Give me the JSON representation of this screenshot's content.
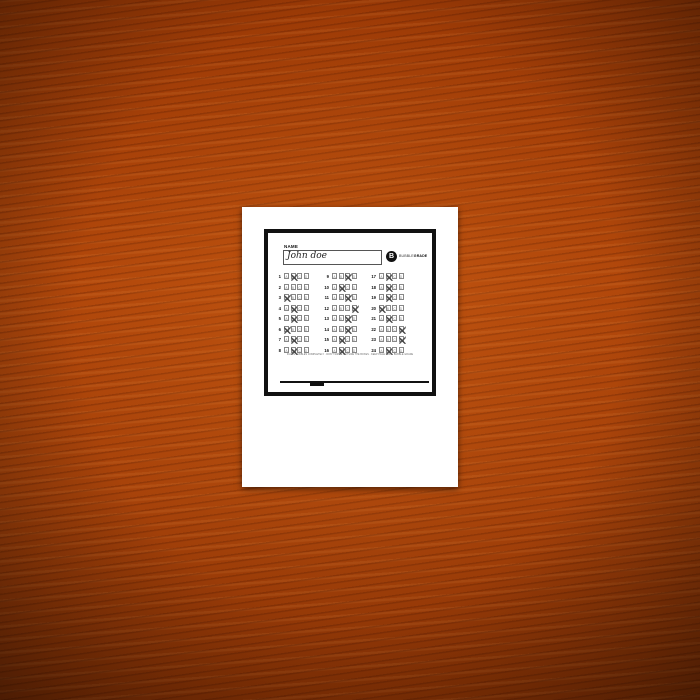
{
  "sheet": {
    "name_label": "NAME",
    "name_value": "John doe",
    "logo_letter": "B",
    "logo_text_plain": "BUBBLE",
    "logo_text_bold": "GRADE",
    "instructions": "FILL IN BUBBLES COMPLETELY · DON'T WRITE OUTSIDE THE BOXES · KEEP PAGE FLAT · BUBBLE·GRADE",
    "choices": [
      "A",
      "B",
      "C",
      "D"
    ],
    "columns": [
      [
        {
          "num": "1",
          "marked": [
            1
          ]
        },
        {
          "num": "2",
          "marked": []
        },
        {
          "num": "3",
          "marked": [
            0
          ]
        },
        {
          "num": "4",
          "marked": [
            1
          ]
        },
        {
          "num": "5",
          "marked": [
            1
          ]
        },
        {
          "num": "6",
          "marked": [
            0
          ]
        },
        {
          "num": "7",
          "marked": [
            1
          ]
        },
        {
          "num": "8",
          "marked": [
            1
          ]
        }
      ],
      [
        {
          "num": "9",
          "marked": [
            2
          ]
        },
        {
          "num": "10",
          "marked": [
            1
          ]
        },
        {
          "num": "11",
          "marked": [
            2
          ]
        },
        {
          "num": "12",
          "marked": [
            3
          ]
        },
        {
          "num": "13",
          "marked": [
            2
          ]
        },
        {
          "num": "14",
          "marked": [
            2
          ]
        },
        {
          "num": "15",
          "marked": [
            1
          ]
        },
        {
          "num": "16",
          "marked": [
            1
          ]
        }
      ],
      [
        {
          "num": "17",
          "marked": [
            1
          ]
        },
        {
          "num": "18",
          "marked": [
            1
          ]
        },
        {
          "num": "19",
          "marked": [
            1
          ]
        },
        {
          "num": "20",
          "marked": [
            0
          ]
        },
        {
          "num": "21",
          "marked": [
            1
          ]
        },
        {
          "num": "22",
          "marked": [
            3
          ]
        },
        {
          "num": "23",
          "marked": [
            3
          ]
        },
        {
          "num": "24",
          "marked": [
            1
          ]
        }
      ]
    ]
  }
}
